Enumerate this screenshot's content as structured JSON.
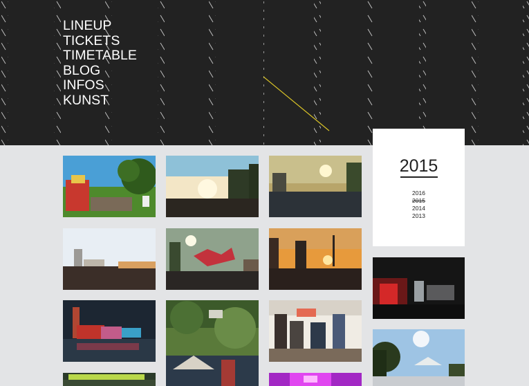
{
  "nav": {
    "items": [
      "LINEUP",
      "TICKETS",
      "TIMETABLE",
      "BLOG",
      "INFOS",
      "KUNST"
    ]
  },
  "archive": {
    "current_year": "2015",
    "years": [
      "2016",
      "2015",
      "2014",
      "2013"
    ]
  },
  "colors": {
    "header_bg": "#222222",
    "page_bg": "#e3e4e6",
    "accent_line": "#d8c227"
  }
}
